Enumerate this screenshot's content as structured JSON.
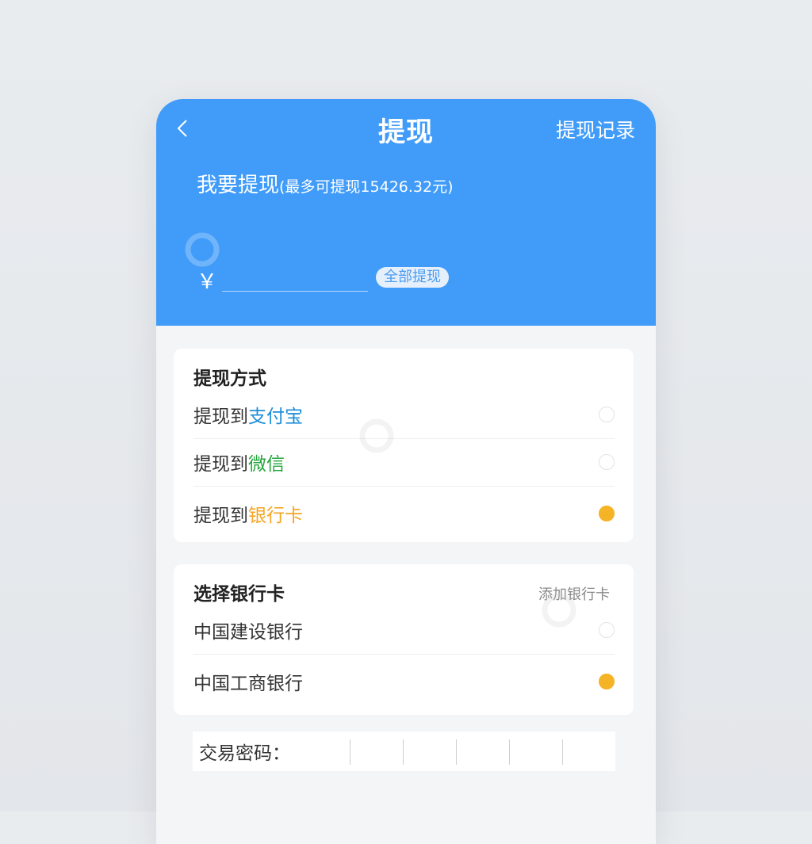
{
  "nav": {
    "title": "提现",
    "right_label": "提现记录",
    "back_icon": "chevron-left-icon"
  },
  "withdraw": {
    "label": "我要提现",
    "max_note": "(最多可提现15426.32元)",
    "currency": "￥",
    "amount_value": "",
    "all_button": "全部提现"
  },
  "method": {
    "title": "提现方式",
    "items": [
      {
        "prefix": "提现到",
        "name": "支付宝",
        "color": "#1f8ed8",
        "selected": false
      },
      {
        "prefix": "提现到",
        "name": "微信",
        "color": "#22a53c",
        "selected": false
      },
      {
        "prefix": "提现到",
        "name": "银行卡",
        "color": "#f5a623",
        "selected": true
      }
    ]
  },
  "bank": {
    "title": "选择银行卡",
    "add_label": "添加银行卡",
    "items": [
      {
        "name": "中国建设银行",
        "selected": false
      },
      {
        "name": "中国工商银行",
        "selected": true
      }
    ]
  },
  "password": {
    "label": "交易密码："
  },
  "colors": {
    "primary": "#419cf9",
    "radio_on": "#f5b326"
  }
}
